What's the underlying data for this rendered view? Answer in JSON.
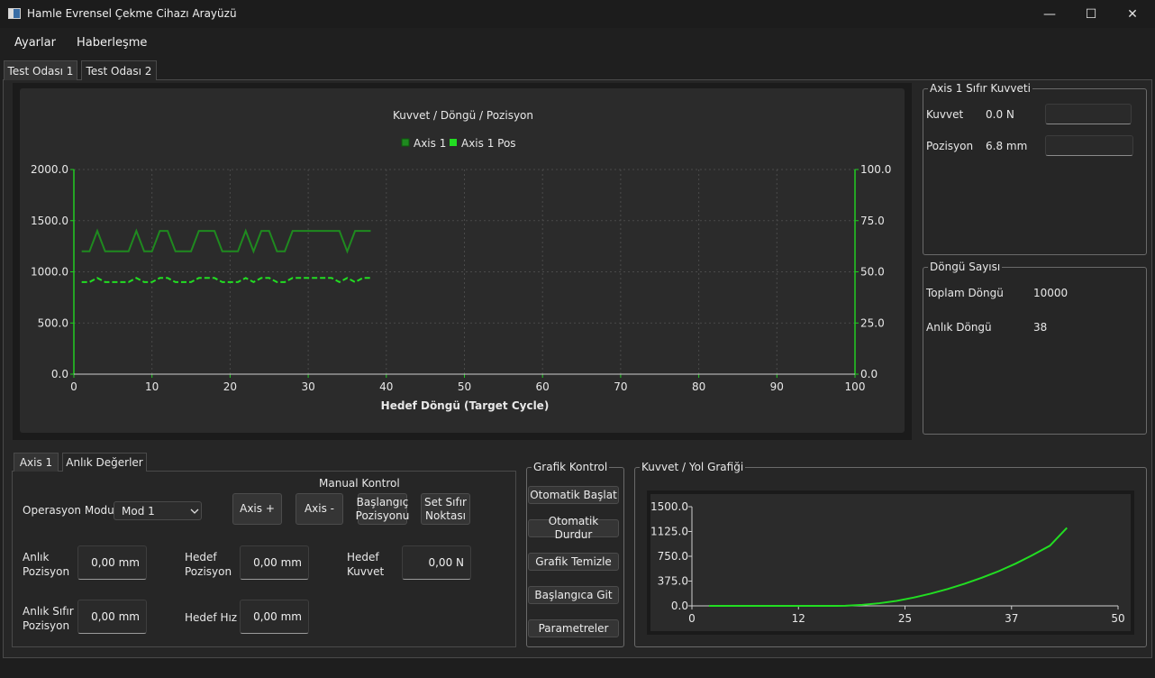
{
  "window": {
    "title": "Hamle Evrensel Çekme Cihazı Arayüzü",
    "minimize": "—",
    "maximize": "☐",
    "close": "✕"
  },
  "menu": {
    "items": [
      "Ayarlar",
      "Haberleşme"
    ]
  },
  "tabs": [
    {
      "label": "Test Odası 1",
      "active": true
    },
    {
      "label": "Test Odası 2",
      "active": false
    }
  ],
  "chart_data": [
    {
      "type": "line",
      "title": "Kuvvet / Döngü / Pozisyon",
      "xlabel": "Hedef Döngü (Target Cycle)",
      "xlim": [
        0,
        100
      ],
      "ylim": [
        0,
        2000
      ],
      "y2lim": [
        0,
        100
      ],
      "xticks": [
        "0",
        "10",
        "20",
        "30",
        "40",
        "50",
        "60",
        "70",
        "80",
        "90",
        "100"
      ],
      "yticks": [
        "0.0",
        "500.0",
        "1000.0",
        "1500.0",
        "2000.0"
      ],
      "y2ticks": [
        "0.0",
        "25.0",
        "50.0",
        "75.0",
        "100.0"
      ],
      "grid": true,
      "legend_position": "top-center",
      "x": [
        1,
        2,
        3,
        4,
        5,
        6,
        7,
        8,
        9,
        10,
        11,
        12,
        13,
        14,
        15,
        16,
        17,
        18,
        19,
        20,
        21,
        22,
        23,
        24,
        25,
        26,
        27,
        28,
        29,
        30,
        31,
        32,
        33,
        34,
        35,
        36,
        37,
        38
      ],
      "series": [
        {
          "name": "Axis 1",
          "axis": "left",
          "color": "#1f8a1f",
          "style": "solid",
          "values": [
            1200,
            1200,
            1400,
            1200,
            1200,
            1200,
            1200,
            1400,
            1200,
            1200,
            1400,
            1400,
            1200,
            1200,
            1200,
            1400,
            1400,
            1400,
            1200,
            1200,
            1200,
            1400,
            1200,
            1400,
            1400,
            1200,
            1200,
            1400,
            1400,
            1400,
            1400,
            1400,
            1400,
            1400,
            1200,
            1400,
            1400,
            1400
          ]
        },
        {
          "name": "Axis 1 Pos",
          "axis": "right",
          "color": "#22dd22",
          "style": "dashed",
          "values": [
            45,
            45,
            47,
            45,
            45,
            45,
            45,
            47,
            45,
            45,
            47,
            47,
            45,
            45,
            45,
            47,
            47,
            47,
            45,
            45,
            45,
            47,
            45,
            47,
            47,
            45,
            45,
            47,
            47,
            47,
            47,
            47,
            47,
            45,
            47,
            45,
            47,
            47
          ]
        }
      ]
    },
    {
      "type": "line",
      "title": "Kuvvet / Yol Grafiği",
      "xlim": [
        0,
        50
      ],
      "ylim": [
        0,
        1500
      ],
      "xticks": [
        "0",
        "12",
        "25",
        "37",
        "50"
      ],
      "yticks": [
        "0.0",
        "375.0",
        "750.0",
        "1125.0",
        "1500.0"
      ],
      "series": [
        {
          "color": "#22dd22",
          "x": [
            2,
            4,
            6,
            8,
            10,
            12,
            14,
            16,
            17,
            18,
            20,
            22,
            24,
            26,
            28,
            30,
            32,
            34,
            36,
            38,
            40,
            42,
            44
          ],
          "values": [
            0,
            0,
            0,
            0,
            0,
            0,
            0,
            0,
            0,
            2,
            15,
            40,
            75,
            125,
            185,
            255,
            335,
            425,
            525,
            640,
            770,
            910,
            1180
          ]
        }
      ]
    }
  ],
  "zero_force": {
    "title": "Axis 1 Sıfır Kuvveti",
    "force_label": "Kuvvet",
    "force_value": "0.0 N",
    "position_label": "Pozisyon",
    "position_value": "6.8 mm"
  },
  "cycles": {
    "title": "Döngü Sayısı",
    "total_label": "Toplam Döngü",
    "total_value": "10000",
    "current_label": "Anlık Döngü",
    "current_value": "38"
  },
  "subtabs": [
    {
      "label": "Axis 1",
      "active": true
    },
    {
      "label": "Anlık Değerler",
      "active": false
    }
  ],
  "control": {
    "manual_title": "Manual Kontrol",
    "mode_label": "Operasyon Modu:",
    "mode_value": "Mod 1",
    "axis_plus": "Axis +",
    "axis_minus": "Axis -",
    "start_pos_1": "Başlangıç",
    "start_pos_2": "Pozisyonu",
    "set_zero_1": "Set Sıfır",
    "set_zero_2": "Noktası",
    "current_pos_1": "Anlık",
    "current_pos_2": "Pozisyon",
    "current_pos_value": "0,00 mm",
    "target_pos_1": "Hedef",
    "target_pos_2": "Pozisyon",
    "target_pos_value": "0,00 mm",
    "target_force_1": "Hedef",
    "target_force_2": "Kuvvet",
    "target_force_value": "0,00 N",
    "zero_pos_1": "Anlık Sıfır",
    "zero_pos_2": "Pozisyon",
    "zero_pos_value": "0,00 mm",
    "target_speed_label": "Hedef Hız",
    "target_speed_value": "0,00 mm"
  },
  "graph_control": {
    "title": "Grafik Kontrol",
    "buttons": [
      "Otomatik Başlat",
      "Otomatik Durdur",
      "Grafik Temizle",
      "Başlangıca Git",
      "Parametreler"
    ]
  },
  "colors": {
    "background": "#1f1f1f",
    "panel": "#262626",
    "chart_bg": "#2b2b2b",
    "axis_green": "#22cc22",
    "series_dark": "#1f8a1f",
    "series_light": "#22dd22"
  }
}
